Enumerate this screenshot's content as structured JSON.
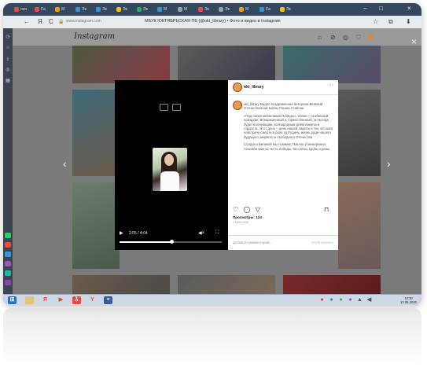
{
  "browser": {
    "tabs": [
      {
        "label": "ozo",
        "color": "#e74c3c"
      },
      {
        "label": "Fa",
        "color": "#e74c3c"
      },
      {
        "label": "M",
        "color": "#f39c12"
      },
      {
        "label": "Эк",
        "color": "#3498db"
      },
      {
        "label": "Эк",
        "color": "#3498db"
      },
      {
        "label": "Эк",
        "color": "#f1c40f"
      },
      {
        "label": "Эк",
        "color": "#27ae60"
      },
      {
        "label": "M",
        "color": "#3498db"
      },
      {
        "label": "M",
        "color": "#95a5a6"
      },
      {
        "label": "Эк",
        "color": "#e74c3c"
      },
      {
        "label": "Эк",
        "color": "#95a5a6"
      },
      {
        "label": "M",
        "color": "#f39c12"
      },
      {
        "label": "Fa",
        "color": "#3498db"
      },
      {
        "label": "Эк",
        "color": "#f1c40f"
      }
    ],
    "active_tab": "",
    "url": "www.instagram.com",
    "page_title": "МБУК ЮКТЯБРЬСКАЯ ПБ (@okt_library) • Фото и видео в Instagram"
  },
  "instagram": {
    "logo": "Instagram"
  },
  "post": {
    "username": "okt_library",
    "caption_paragraphs": [
      "okt_library Видео поздравление ветерана Великой Отечественной войны Рюана Ставчак.",
      "«Под салютом Великой Победы», 9 Мая – особенный праздник. Вневременный и торжественный, он всегда будет волнующим, всенародным днём памяти и гордости. Этот день – день нашей памяти и тех, кто шёл навстречу смерти в боях за Родину, жизнь ради нашего будущего, мирного и свободного Отечества.",
      "Солдаты Великой мы помним, Поклон у мемориала. Спасибо вам за честь победы, За слёзы, кровь и раны."
    ],
    "views": "Просмотры: 124",
    "date": "4 МАЯ 2020",
    "comment_placeholder": "Добавьте комментарий...",
    "publish_label": "Опубликовать",
    "video_time": "2:05 / 4:04",
    "video_progress": 0.51
  },
  "taskbar": {
    "time": "10:30",
    "date": "13.05.2020"
  }
}
